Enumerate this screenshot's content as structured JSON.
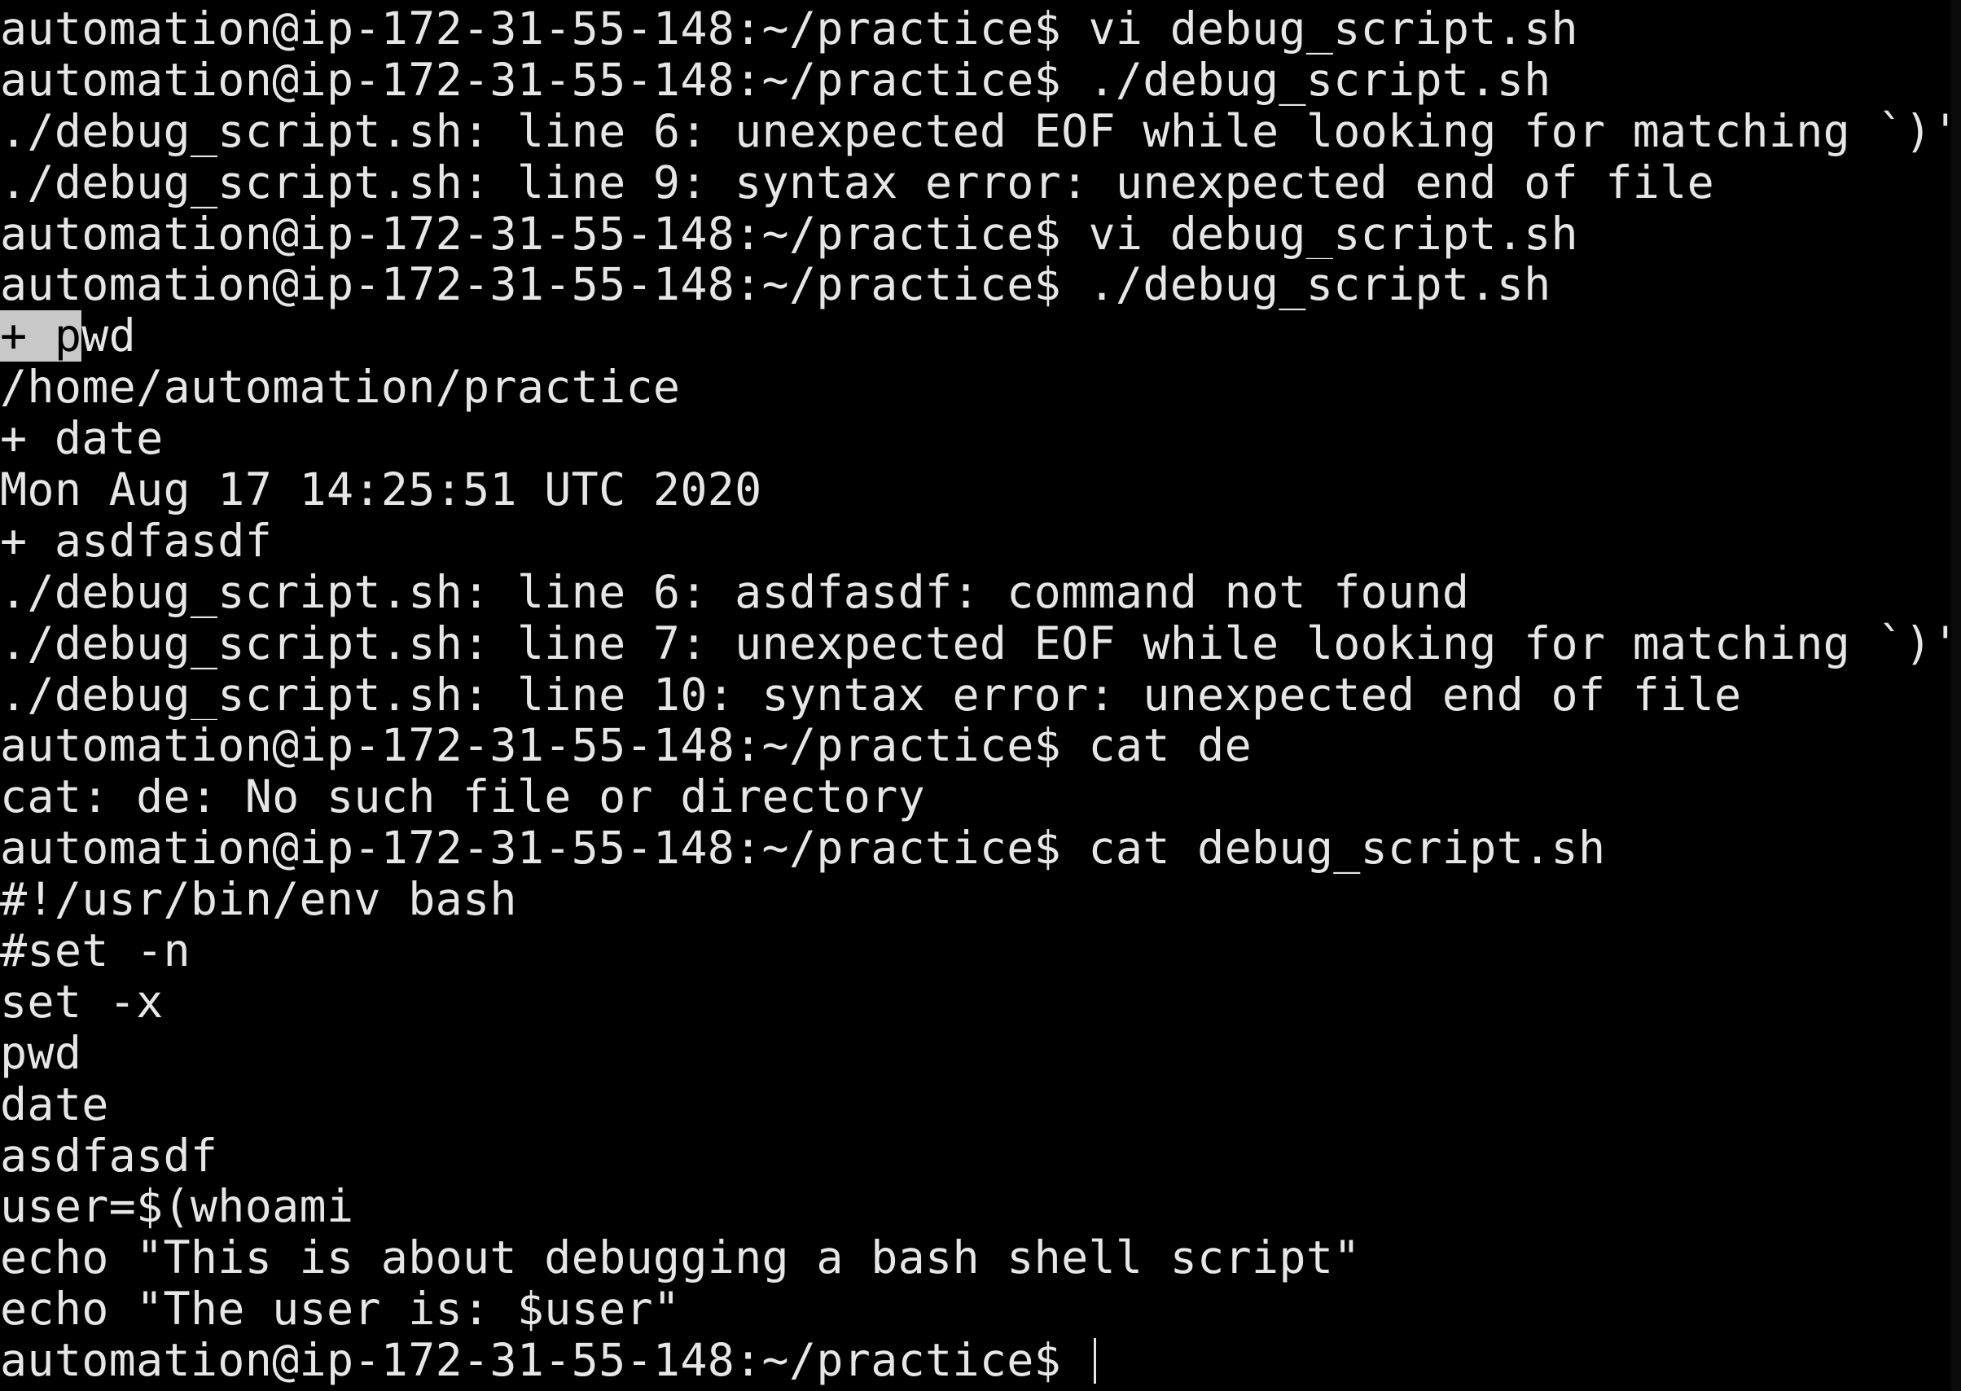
{
  "terminal": {
    "prompt": "automation@ip-172-31-55-148:~/practice$ ",
    "lines": [
      "automation@ip-172-31-55-148:~/practice$ vi debug_script.sh",
      "automation@ip-172-31-55-148:~/practice$ ./debug_script.sh",
      "./debug_script.sh: line 6: unexpected EOF while looking for matching `)'",
      "./debug_script.sh: line 9: syntax error: unexpected end of file",
      "automation@ip-172-31-55-148:~/practice$ vi debug_script.sh",
      "automation@ip-172-31-55-148:~/practice$ ./debug_script.sh",
      "+ pwd",
      "/home/automation/practice",
      "+ date",
      "Mon Aug 17 14:25:51 UTC 2020",
      "+ asdfasdf",
      "./debug_script.sh: line 6: asdfasdf: command not found",
      "./debug_script.sh: line 7: unexpected EOF while looking for matching `)'",
      "./debug_script.sh: line 10: syntax error: unexpected end of file",
      "automation@ip-172-31-55-148:~/practice$ cat de",
      "cat: de: No such file or directory",
      "automation@ip-172-31-55-148:~/practice$ cat debug_script.sh",
      "#!/usr/bin/env bash",
      "#set -n",
      "set -x",
      "pwd",
      "date",
      "asdfasdf",
      "user=$(whoami",
      "echo \"This is about debugging a bash shell script\"",
      "echo \"The user is: $user\""
    ],
    "selection_prefix": "+ p",
    "selection_rest": "wd",
    "final_prompt": "automation@ip-172-31-55-148:~/practice$ ",
    "colors": {
      "background": "#000000",
      "foreground": "#e6e6e6",
      "selection": "#c8c8c8"
    }
  }
}
